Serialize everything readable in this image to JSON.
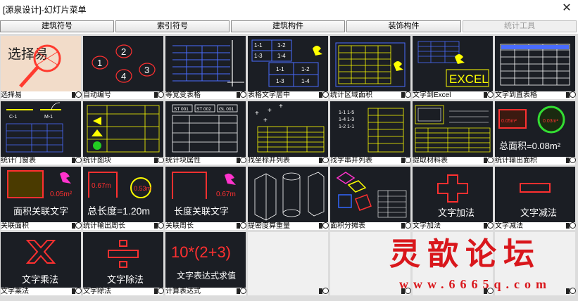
{
  "window": {
    "title": "[源泉设计]-幻灯片菜单"
  },
  "tabs": [
    {
      "label": "建筑符号"
    },
    {
      "label": "索引符号"
    },
    {
      "label": "建筑构件"
    },
    {
      "label": "装饰构件"
    },
    {
      "label": "统计工具"
    }
  ],
  "tiles": [
    {
      "label": "选择易",
      "caption": "选择易"
    },
    {
      "label": "自动编号",
      "nums": [
        "1",
        "2",
        "4",
        "3"
      ]
    },
    {
      "label": "等宽变表格"
    },
    {
      "label": "表格文字居中",
      "cells": [
        "1-1",
        "1-2",
        "1-3",
        "1-4",
        "1-1",
        "1-2",
        "1-3",
        "1-4"
      ]
    },
    {
      "label": "统计区域面积"
    },
    {
      "label": "文字到Excel",
      "caption": "EXCEL"
    },
    {
      "label": "文字到直表格"
    },
    {
      "label": "统计门窗表",
      "tags": [
        "C-1",
        "M-1"
      ]
    },
    {
      "label": "统计图块"
    },
    {
      "label": "统计块属性",
      "heads": [
        "ST 001",
        "ST 002",
        "GL 001"
      ]
    },
    {
      "label": "找坐标并列表"
    },
    {
      "label": "找字串并列表",
      "cells": [
        "1-1",
        "1-5",
        "1-4",
        "1-3",
        "1-2",
        "1-1"
      ]
    },
    {
      "label": "提取材料表"
    },
    {
      "label": "统计输出面积",
      "caption": "总面积=0.08m²",
      "badges": [
        "0.05m²",
        "0.03m²"
      ]
    },
    {
      "label": "关联面积",
      "caption": "面积关联文字",
      "value": "0.05m²"
    },
    {
      "label": "统计输出周长",
      "caption": "总长度=1.20m",
      "values": [
        "0.67m",
        "0.53m"
      ]
    },
    {
      "label": "关联周长",
      "caption": "长度关联文字",
      "value": "0.67m"
    },
    {
      "label": "提密度算重量"
    },
    {
      "label": "面积分摊表"
    },
    {
      "label": "文字加法",
      "caption": "文字加法"
    },
    {
      "label": "文字减法",
      "caption": "文字减法"
    },
    {
      "label": "文字乘法",
      "caption": "文字乘法"
    },
    {
      "label": "文字除法",
      "caption": "文字除法"
    },
    {
      "label": "计算表达式",
      "formula": "10*(2+3)",
      "caption": "文字表达式求值"
    },
    {
      "label": ""
    },
    {
      "label": ""
    },
    {
      "label": ""
    },
    {
      "label": ""
    }
  ],
  "watermark": {
    "brand": "灵歆论坛",
    "url": "www.6665q.com"
  },
  "colors": {
    "thumb_bg": "#1b1e24",
    "accent_red": "#d9171c",
    "cad_yellow": "#ffff00",
    "cad_blue": "#4a6cff"
  }
}
